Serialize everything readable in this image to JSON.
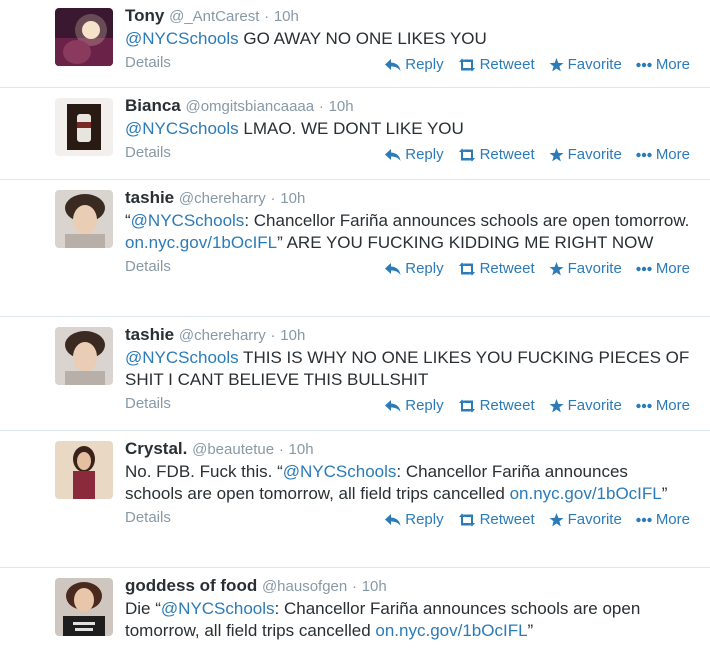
{
  "common": {
    "details_label": "Details",
    "reply_label": "Reply",
    "retweet_label": "Retweet",
    "favorite_label": "Favorite",
    "more_label": "More",
    "accent_color": "#2b7bb9"
  },
  "tweets": [
    {
      "name": "Tony",
      "handle": "@_AntCarest",
      "time": "10h",
      "parts": [
        {
          "t": "mention",
          "v": "@NYCSchools"
        },
        {
          "t": "text",
          "v": " GO AWAY NO ONE LIKES YOU"
        }
      ]
    },
    {
      "name": "Bianca",
      "handle": "@omgitsbiancaaaa",
      "time": "10h",
      "parts": [
        {
          "t": "mention",
          "v": "@NYCSchools"
        },
        {
          "t": "text",
          "v": " LMAO. WE DONT LIKE YOU"
        }
      ]
    },
    {
      "name": "tashie",
      "handle": "@chereharry",
      "time": "10h",
      "parts": [
        {
          "t": "text",
          "v": "“"
        },
        {
          "t": "mention",
          "v": "@NYCSchools"
        },
        {
          "t": "text",
          "v": ": Chancellor Fariña announces schools are open tomorrow. "
        },
        {
          "t": "link",
          "v": "on.nyc.gov/1bOcIFL"
        },
        {
          "t": "text",
          "v": "” ARE YOU FUCKING KIDDING ME RIGHT NOW"
        }
      ]
    },
    {
      "name": "tashie",
      "handle": "@chereharry",
      "time": "10h",
      "parts": [
        {
          "t": "mention",
          "v": "@NYCSchools"
        },
        {
          "t": "text",
          "v": " THIS IS WHY NO ONE LIKES YOU FUCKING PIECES OF SHIT I CANT BELIEVE THIS BULLSHIT"
        }
      ]
    },
    {
      "name": "Crystal.",
      "handle": "@beautetue",
      "time": "10h",
      "parts": [
        {
          "t": "text",
          "v": "No. FDB. Fuck this. “"
        },
        {
          "t": "mention",
          "v": "@NYCSchools"
        },
        {
          "t": "text",
          "v": ": Chancellor Fariña announces schools are open tomorrow, all field trips cancelled "
        },
        {
          "t": "link",
          "v": "on.nyc.gov/1bOcIFL"
        },
        {
          "t": "text",
          "v": "”"
        }
      ]
    },
    {
      "name": "goddess of food",
      "handle": "@hausofgen",
      "time": "10h",
      "parts": [
        {
          "t": "text",
          "v": "Die “"
        },
        {
          "t": "mention",
          "v": "@NYCSchools"
        },
        {
          "t": "text",
          "v": ": Chancellor Fariña announces schools are open tomorrow, all field trips cancelled "
        },
        {
          "t": "link",
          "v": "on.nyc.gov/1bOcIFL"
        },
        {
          "t": "text",
          "v": "”"
        }
      ]
    }
  ]
}
